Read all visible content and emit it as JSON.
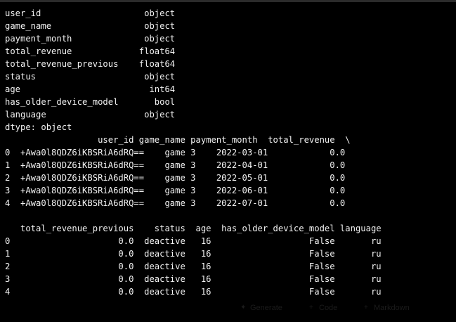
{
  "output_lines": [
    "user_id                    object",
    "game_name                  object",
    "payment_month              object",
    "total_revenue             float64",
    "total_revenue_previous    float64",
    "status                     object",
    "age                         int64",
    "has_older_device_model       bool",
    "language                   object",
    "dtype: object",
    "                  user_id game_name payment_month  total_revenue  \\",
    "0  +Awa0l8QDZ6iKBSRiA6dRQ==    game 3    2022-03-01            0.0",
    "1  +Awa0l8QDZ6iKBSRiA6dRQ==    game 3    2022-04-01            0.0",
    "2  +Awa0l8QDZ6iKBSRiA6dRQ==    game 3    2022-05-01            0.0",
    "3  +Awa0l8QDZ6iKBSRiA6dRQ==    game 3    2022-06-01            0.0",
    "4  +Awa0l8QDZ6iKBSRiA6dRQ==    game 3    2022-07-01            0.0",
    "",
    "   total_revenue_previous    status  age  has_older_device_model language",
    "0                     0.0  deactive   16                   False       ru",
    "1                     0.0  deactive   16                   False       ru",
    "2                     0.0  deactive   16                   False       ru",
    "3                     0.0  deactive   16                   False       ru",
    "4                     0.0  deactive   16                   False       ru"
  ],
  "cell_toolbar": {
    "generate_label": "Generate",
    "code_label": "Code",
    "markdown_label": "Markdown"
  },
  "colors": {
    "background": "#000000",
    "text": "#f2f2f2",
    "toolbar_ghost": "#1b1b1b"
  }
}
